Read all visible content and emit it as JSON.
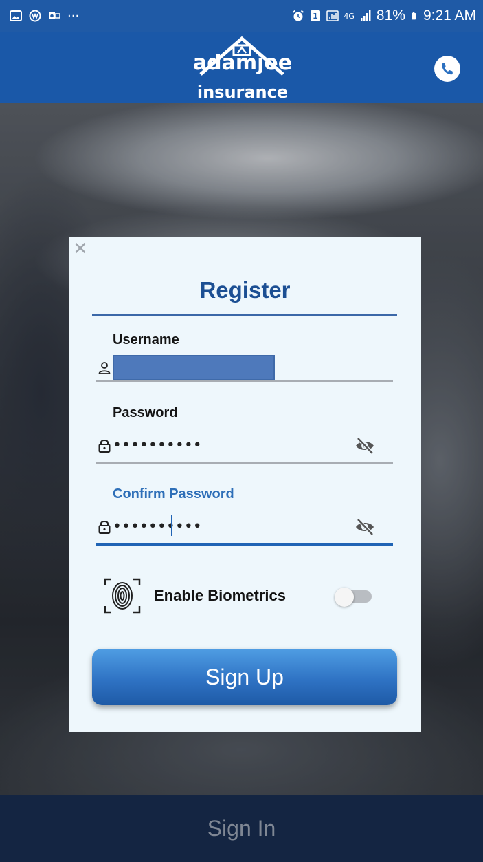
{
  "status_bar": {
    "more": "···",
    "network": "4G",
    "battery": "81%",
    "time": "9:21 AM",
    "left_icons": [
      "gallery-icon",
      "whatsapp-icon",
      "outlook-icon"
    ],
    "right_icons": [
      "alarm-icon",
      "sim-icon",
      "data-saver-icon",
      "signal-icon",
      "battery-icon"
    ]
  },
  "header": {
    "logo_line1": "adamjee",
    "logo_line2": "insurance",
    "background_color": "#1a58a8",
    "phone_icon": "phone-icon"
  },
  "dialog": {
    "title": "Register",
    "close_icon": "close-icon",
    "username": {
      "label": "Username",
      "icon": "user-icon",
      "value_redacted": true
    },
    "password": {
      "label": "Password",
      "masked_value": "••••••••••",
      "icon": "lock-icon",
      "toggle_icon": "eye-off-icon"
    },
    "confirm_password": {
      "label": "Confirm Password",
      "masked_value": "••••••••••",
      "icon": "lock-icon",
      "toggle_icon": "eye-off-icon",
      "focused": true
    },
    "biometrics": {
      "label": "Enable Biometrics",
      "icon": "fingerprint-icon",
      "enabled": false
    },
    "submit_label": "Sign Up",
    "accent_color": "#1c4f93"
  },
  "footer": {
    "signin_label": "Sign In"
  }
}
